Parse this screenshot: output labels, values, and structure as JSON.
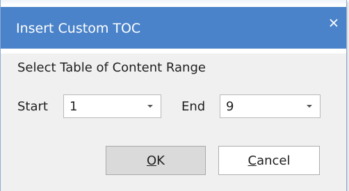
{
  "window": {
    "title": "Insert Custom TOC",
    "close_icon": "close-icon",
    "accent_color": "#4a83c9"
  },
  "section": {
    "label": "Select Table of Content Range"
  },
  "start": {
    "label": "Start",
    "value": "1",
    "dropdown_icon": "chevron-down-icon"
  },
  "end": {
    "label": "End",
    "value": "9",
    "dropdown_icon": "chevron-down-icon"
  },
  "buttons": {
    "ok": {
      "mnemonic": "O",
      "rest": "K"
    },
    "cancel": {
      "mnemonic": "C",
      "rest": "ancel"
    }
  }
}
